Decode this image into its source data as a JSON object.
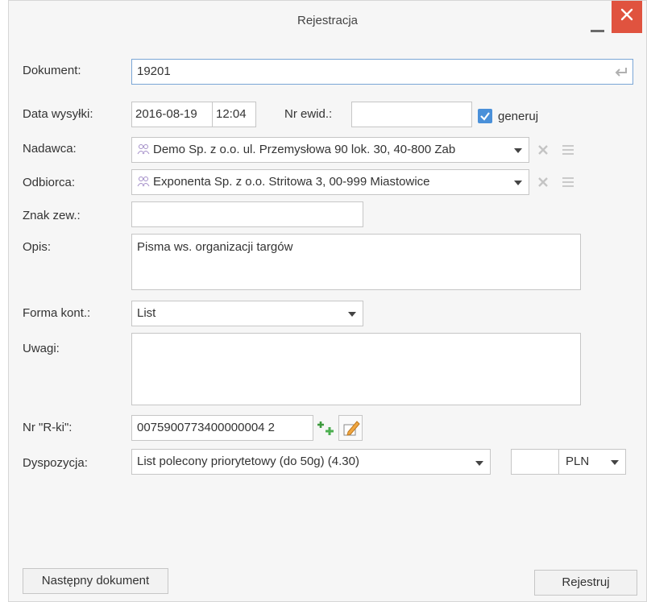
{
  "window": {
    "title": "Rejestracja"
  },
  "form": {
    "dokument": {
      "label": "Dokument:",
      "value": "19201"
    },
    "data_wysylki": {
      "label": "Data wysyłki:",
      "date": "2016-08-19",
      "time": "12:04"
    },
    "nr_ewid": {
      "label": "Nr ewid.:",
      "value": "",
      "generate_label": "generuj",
      "generate_checked": true
    },
    "nadawca": {
      "label": "Nadawca:",
      "value": "Demo Sp. z o.o. ul. Przemysłowa 90 lok. 30, 40-800 Zab"
    },
    "odbiorca": {
      "label": "Odbiorca:",
      "value": "Exponenta Sp. z o.o. Stritowa 3, 00-999 Miastowice"
    },
    "znak_zew": {
      "label": "Znak zew.:",
      "value": ""
    },
    "opis": {
      "label": "Opis:",
      "value": "Pisma ws. organizacji targów"
    },
    "forma_kont": {
      "label": "Forma kont.:",
      "value": "List"
    },
    "uwagi": {
      "label": "Uwagi:",
      "value": ""
    },
    "nr_rki": {
      "label": "Nr \"R-ki\":",
      "value": "0075900773400000004 2"
    },
    "dyspozycja": {
      "label": "Dyspozycja:",
      "value": "List polecony priorytetowy (do 50g) (4.30)",
      "amount": "",
      "currency": "PLN"
    }
  },
  "buttons": {
    "next": "Następny dokument",
    "register": "Rejestruj"
  },
  "colors": {
    "close": "#e0533f",
    "checkbox": "#4a90d9",
    "focus_border": "#7aa6d6",
    "add_icon": "#4caf50"
  }
}
